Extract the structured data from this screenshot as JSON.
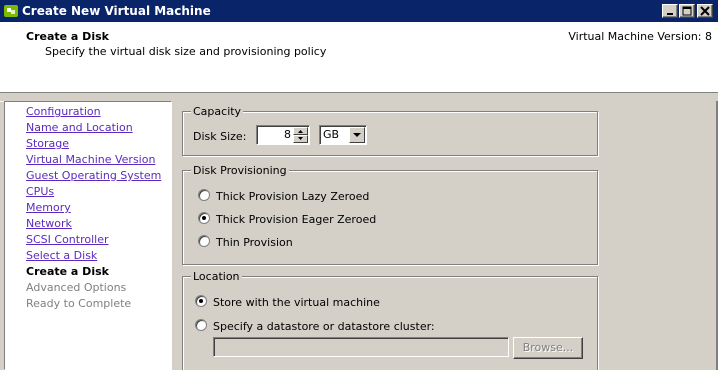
{
  "window": {
    "title": "Create New Virtual Machine",
    "icon": "vmware-logo-icon",
    "controls": [
      "minimize-icon",
      "maximize-icon",
      "close-icon"
    ]
  },
  "header": {
    "title": "Create a Disk",
    "subtitle": "Specify the virtual disk size and provisioning policy",
    "version": "Virtual Machine Version: 8"
  },
  "nav": {
    "items": [
      {
        "label": "Configuration",
        "state": "link"
      },
      {
        "label": "Name and Location",
        "state": "link"
      },
      {
        "label": "Storage",
        "state": "link"
      },
      {
        "label": "Virtual Machine Version",
        "state": "link"
      },
      {
        "label": "Guest Operating System",
        "state": "link"
      },
      {
        "label": "CPUs",
        "state": "link"
      },
      {
        "label": "Memory",
        "state": "link"
      },
      {
        "label": "Network",
        "state": "link"
      },
      {
        "label": "SCSI Controller",
        "state": "link"
      },
      {
        "label": "Select a Disk",
        "state": "link"
      },
      {
        "label": "Create a Disk",
        "state": "current"
      },
      {
        "label": "Advanced Options",
        "state": "disabled"
      },
      {
        "label": "Ready to Complete",
        "state": "disabled"
      }
    ]
  },
  "capacity": {
    "legend": "Capacity",
    "disk_size_label": "Disk Size:",
    "disk_size_value": "8",
    "unit": "GB"
  },
  "provisioning": {
    "legend": "Disk Provisioning",
    "options": [
      {
        "label": "Thick Provision Lazy Zeroed",
        "selected": false
      },
      {
        "label": "Thick Provision Eager Zeroed",
        "selected": true
      },
      {
        "label": "Thin Provision",
        "selected": false
      }
    ]
  },
  "location": {
    "legend": "Location",
    "options": [
      {
        "label": "Store with the virtual machine",
        "selected": true
      },
      {
        "label": "Specify a datastore or datastore cluster:",
        "selected": false
      }
    ],
    "datastore_value": "",
    "browse_label": "Browse..."
  }
}
